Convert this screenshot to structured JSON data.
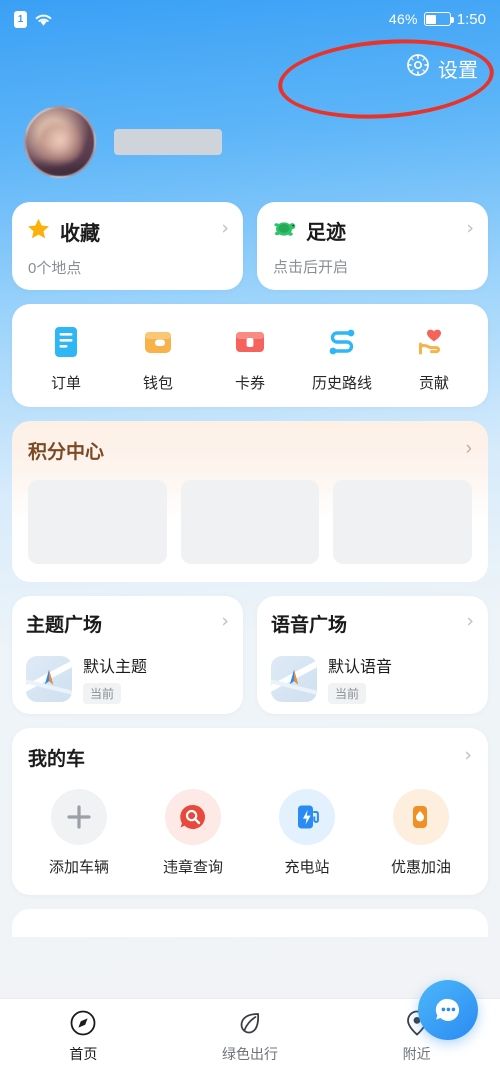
{
  "status_bar": {
    "sim_label": "1",
    "wifi_icon": "wifi-icon",
    "battery_percent": "46%",
    "battery_icon": "battery-icon",
    "clock": "1:50"
  },
  "header": {
    "settings_label": "设置",
    "settings_icon": "gear-icon",
    "annotation": "red-ellipse-highlight"
  },
  "profile": {
    "avatar_icon": "user-avatar",
    "nickname": ""
  },
  "shortcuts": {
    "favorites": {
      "title": "收藏",
      "subtitle": "0个地点",
      "icon": "star-icon"
    },
    "footprints": {
      "title": "足迹",
      "subtitle": "点击后开启",
      "icon": "turtle-icon"
    }
  },
  "quick_grid": [
    {
      "label": "订单",
      "icon": "order-list-icon",
      "color": "#2fb6f5"
    },
    {
      "label": "钱包",
      "icon": "wallet-icon",
      "color": "#f7b24a"
    },
    {
      "label": "卡券",
      "icon": "coupon-card-icon",
      "color": "#f4645c"
    },
    {
      "label": "历史路线",
      "icon": "route-history-icon",
      "color": "#2fb6f5"
    },
    {
      "label": "贡献",
      "icon": "heart-hand-icon",
      "color": "#f4645c"
    }
  ],
  "points_center": {
    "title": "积分中心",
    "arrow_icon": "chevron-right-icon",
    "placeholder_count": 3
  },
  "theme_square": {
    "title": "主题广场",
    "item_name": "默认主题",
    "tag": "当前",
    "thumb_icon": "map-compass-thumb"
  },
  "voice_square": {
    "title": "语音广场",
    "item_name": "默认语音",
    "tag": "当前",
    "thumb_icon": "map-compass-thumb"
  },
  "my_car": {
    "title": "我的车",
    "items": [
      {
        "label": "添加车辆",
        "icon": "plus-icon",
        "bg": "#f1f2f4",
        "fg": "#9aa0a6"
      },
      {
        "label": "违章查询",
        "icon": "chat-search-icon",
        "bg": "#fde9e6",
        "fg": "#e8493c"
      },
      {
        "label": "充电站",
        "icon": "charging-station-icon",
        "bg": "#e2f0fe",
        "fg": "#2a8bf2"
      },
      {
        "label": "优惠加油",
        "icon": "fuel-pump-icon",
        "bg": "#fdecdc",
        "fg": "#f09024"
      }
    ]
  },
  "tab_bar": {
    "tabs": [
      {
        "label": "首页",
        "icon": "compass-icon",
        "active": true
      },
      {
        "label": "绿色出行",
        "icon": "leaf-icon",
        "active": false
      },
      {
        "label": "附近",
        "icon": "location-pin-icon",
        "active": false
      }
    ],
    "fab_icon": "assistant-bubble-icon"
  },
  "colors": {
    "accent_blue": "#2a8bf2",
    "annotation_red": "#e8332a",
    "points_brown": "#7b4a23"
  }
}
